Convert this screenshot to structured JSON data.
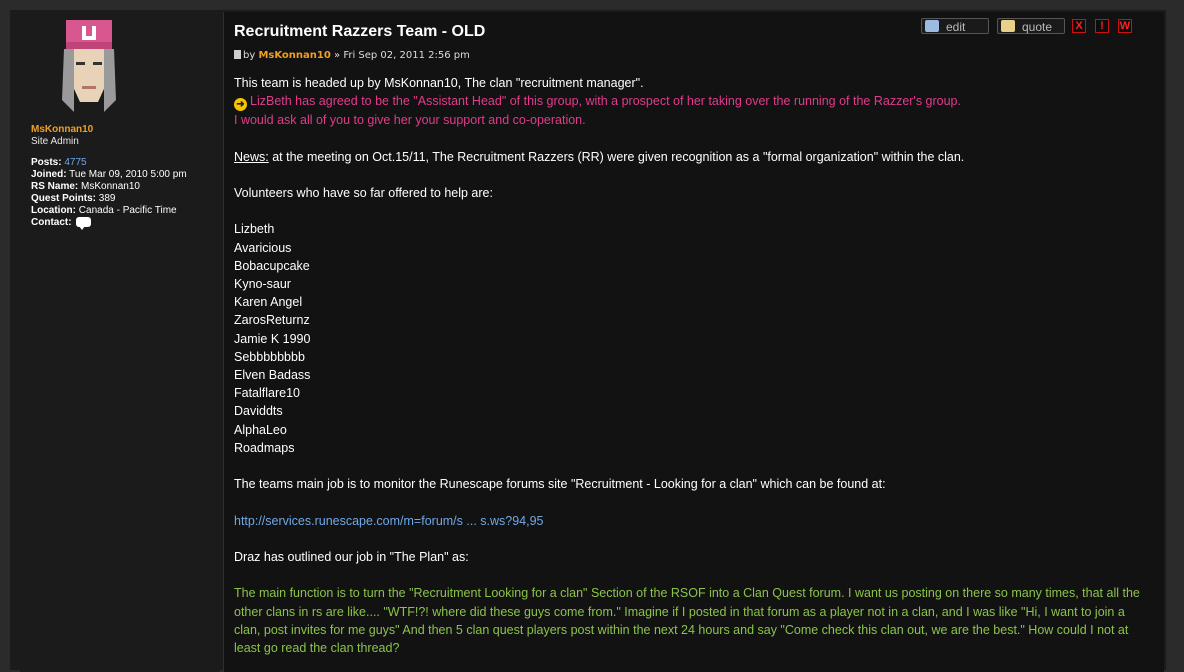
{
  "profile": {
    "username": "MsKonnan10",
    "rank": "Site Admin",
    "fields": [
      {
        "label": "Posts:",
        "value": "4775",
        "link": true
      },
      {
        "label": "Joined:",
        "value": "Tue Mar 09, 2010 5:00 pm"
      },
      {
        "label": "RS Name:",
        "value": "MsKonnan10"
      },
      {
        "label": "Quest Points:",
        "value": "389"
      },
      {
        "label": "Location:",
        "value": "Canada - Pacific Time"
      },
      {
        "label": "Contact:",
        "value": ""
      }
    ]
  },
  "post": {
    "title": "Recruitment Razzers Team - OLD",
    "meta_by": "by",
    "meta_author": "MsKonnan10",
    "meta_date": "» Fri Sep 02, 2011 2:56 pm",
    "buttons": {
      "edit": "edit",
      "quote": "quote",
      "delete": "X",
      "report": "!",
      "warn": "W"
    },
    "lines": {
      "intro": "This team is headed up by MsKonnan10, The clan \"recruitment manager\".",
      "pink1": "LizBeth has agreed to be the \"Assistant Head\" of this group, with a prospect of her taking over the running of the Razzer's group.",
      "pink2": "I would ask all of you to give her your support and co-operation.",
      "news_label": "News:",
      "news_text": " at the meeting on Oct.15/11, The Recruitment Razzers (RR) were given recognition as a \"formal organization\" within the clan.",
      "volunteers": "Volunteers who have so far offered to help are:",
      "members": [
        "Lizbeth",
        "Avaricious",
        "Bobacupcake",
        "Kyno-saur",
        "Karen Angel",
        "ZarosReturnz",
        "Jamie K 1990",
        "Sebbbbbbbb",
        "Elven Badass",
        "Fatalflare10",
        "Daviddts",
        "AlphaLeo",
        "Roadmaps"
      ],
      "job": "The teams main job is to monitor the Runescape forums site \"Recruitment - Looking for a clan\" which can be found at:",
      "url": "http://services.runescape.com/m=forum/s ... s.ws?94,95",
      "plan": "Draz has outlined our job in \"The Plan\" as:",
      "green": "The main function is to turn the \"Recruitment Looking for a clan\" Section of the RSOF into a Clan Quest forum. I want us posting on there so many times, that all the other clans in rs are like.... \"WTF!?! where did these guys come from.\" Imagine if I posted in that forum as a player not in a clan, and I was like \"Hi, I want to join a clan, post invites for me guys\" And then 5 clan quest players post within the next 24 hours and say \"Come check this clan out, we are the best.\" How could I not at least go read the clan thread?"
    }
  },
  "colors": {
    "author": "#f0a020",
    "pink": "#e23a8d",
    "green": "#8bc34a",
    "link": "#6fa8e8",
    "button_red": "#ff2020"
  },
  "icons": {
    "avatar": "avatar-image",
    "arrow": "arrow-right-icon",
    "contact": "speech-bubble-icon",
    "edit": "edit-icon",
    "quote": "quote-icon",
    "post": "document-icon"
  }
}
